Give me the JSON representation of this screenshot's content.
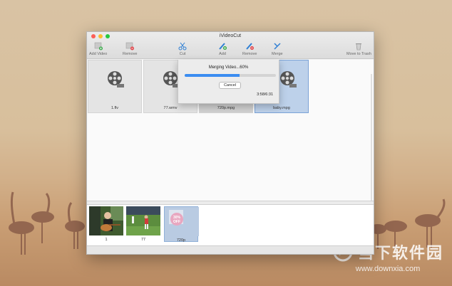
{
  "window": {
    "title": "iVideoCut"
  },
  "toolbar": {
    "add_video": "Add Video",
    "remove_left": "Remove",
    "cut": "Cut",
    "add": "Add",
    "remove": "Remove",
    "merge": "Merge",
    "move_to_trash": "Move to Trash"
  },
  "videos": [
    {
      "name": "1.flv"
    },
    {
      "name": "77.wmv"
    },
    {
      "name": "720p.mpg"
    },
    {
      "name": "baby.mpg"
    }
  ],
  "dialog": {
    "message": "Merging Video...60%",
    "progress": 0.6,
    "cancel": "Cancel",
    "time": "3:58/6:31"
  },
  "clips": [
    {
      "label": "1"
    },
    {
      "label": "77"
    },
    {
      "label": "720p",
      "overlay_text": "30%\nOFF"
    }
  ],
  "watermark": {
    "name": "当下软件园",
    "site": "www.downxia.com"
  },
  "colors": {
    "accent": "#3b8df1",
    "selection": "#bdd1ea"
  }
}
